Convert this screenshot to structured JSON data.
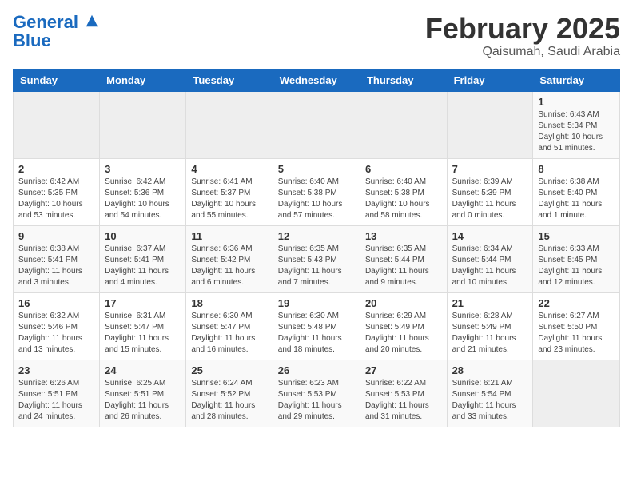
{
  "logo": {
    "line1": "General",
    "line2": "Blue"
  },
  "title": "February 2025",
  "subtitle": "Qaisumah, Saudi Arabia",
  "days_of_week": [
    "Sunday",
    "Monday",
    "Tuesday",
    "Wednesday",
    "Thursday",
    "Friday",
    "Saturday"
  ],
  "weeks": [
    [
      {
        "day": "",
        "info": ""
      },
      {
        "day": "",
        "info": ""
      },
      {
        "day": "",
        "info": ""
      },
      {
        "day": "",
        "info": ""
      },
      {
        "day": "",
        "info": ""
      },
      {
        "day": "",
        "info": ""
      },
      {
        "day": "1",
        "info": "Sunrise: 6:43 AM\nSunset: 5:34 PM\nDaylight: 10 hours\nand 51 minutes."
      }
    ],
    [
      {
        "day": "2",
        "info": "Sunrise: 6:42 AM\nSunset: 5:35 PM\nDaylight: 10 hours\nand 53 minutes."
      },
      {
        "day": "3",
        "info": "Sunrise: 6:42 AM\nSunset: 5:36 PM\nDaylight: 10 hours\nand 54 minutes."
      },
      {
        "day": "4",
        "info": "Sunrise: 6:41 AM\nSunset: 5:37 PM\nDaylight: 10 hours\nand 55 minutes."
      },
      {
        "day": "5",
        "info": "Sunrise: 6:40 AM\nSunset: 5:38 PM\nDaylight: 10 hours\nand 57 minutes."
      },
      {
        "day": "6",
        "info": "Sunrise: 6:40 AM\nSunset: 5:38 PM\nDaylight: 10 hours\nand 58 minutes."
      },
      {
        "day": "7",
        "info": "Sunrise: 6:39 AM\nSunset: 5:39 PM\nDaylight: 11 hours\nand 0 minutes."
      },
      {
        "day": "8",
        "info": "Sunrise: 6:38 AM\nSunset: 5:40 PM\nDaylight: 11 hours\nand 1 minute."
      }
    ],
    [
      {
        "day": "9",
        "info": "Sunrise: 6:38 AM\nSunset: 5:41 PM\nDaylight: 11 hours\nand 3 minutes."
      },
      {
        "day": "10",
        "info": "Sunrise: 6:37 AM\nSunset: 5:41 PM\nDaylight: 11 hours\nand 4 minutes."
      },
      {
        "day": "11",
        "info": "Sunrise: 6:36 AM\nSunset: 5:42 PM\nDaylight: 11 hours\nand 6 minutes."
      },
      {
        "day": "12",
        "info": "Sunrise: 6:35 AM\nSunset: 5:43 PM\nDaylight: 11 hours\nand 7 minutes."
      },
      {
        "day": "13",
        "info": "Sunrise: 6:35 AM\nSunset: 5:44 PM\nDaylight: 11 hours\nand 9 minutes."
      },
      {
        "day": "14",
        "info": "Sunrise: 6:34 AM\nSunset: 5:44 PM\nDaylight: 11 hours\nand 10 minutes."
      },
      {
        "day": "15",
        "info": "Sunrise: 6:33 AM\nSunset: 5:45 PM\nDaylight: 11 hours\nand 12 minutes."
      }
    ],
    [
      {
        "day": "16",
        "info": "Sunrise: 6:32 AM\nSunset: 5:46 PM\nDaylight: 11 hours\nand 13 minutes."
      },
      {
        "day": "17",
        "info": "Sunrise: 6:31 AM\nSunset: 5:47 PM\nDaylight: 11 hours\nand 15 minutes."
      },
      {
        "day": "18",
        "info": "Sunrise: 6:30 AM\nSunset: 5:47 PM\nDaylight: 11 hours\nand 16 minutes."
      },
      {
        "day": "19",
        "info": "Sunrise: 6:30 AM\nSunset: 5:48 PM\nDaylight: 11 hours\nand 18 minutes."
      },
      {
        "day": "20",
        "info": "Sunrise: 6:29 AM\nSunset: 5:49 PM\nDaylight: 11 hours\nand 20 minutes."
      },
      {
        "day": "21",
        "info": "Sunrise: 6:28 AM\nSunset: 5:49 PM\nDaylight: 11 hours\nand 21 minutes."
      },
      {
        "day": "22",
        "info": "Sunrise: 6:27 AM\nSunset: 5:50 PM\nDaylight: 11 hours\nand 23 minutes."
      }
    ],
    [
      {
        "day": "23",
        "info": "Sunrise: 6:26 AM\nSunset: 5:51 PM\nDaylight: 11 hours\nand 24 minutes."
      },
      {
        "day": "24",
        "info": "Sunrise: 6:25 AM\nSunset: 5:51 PM\nDaylight: 11 hours\nand 26 minutes."
      },
      {
        "day": "25",
        "info": "Sunrise: 6:24 AM\nSunset: 5:52 PM\nDaylight: 11 hours\nand 28 minutes."
      },
      {
        "day": "26",
        "info": "Sunrise: 6:23 AM\nSunset: 5:53 PM\nDaylight: 11 hours\nand 29 minutes."
      },
      {
        "day": "27",
        "info": "Sunrise: 6:22 AM\nSunset: 5:53 PM\nDaylight: 11 hours\nand 31 minutes."
      },
      {
        "day": "28",
        "info": "Sunrise: 6:21 AM\nSunset: 5:54 PM\nDaylight: 11 hours\nand 33 minutes."
      },
      {
        "day": "",
        "info": ""
      }
    ]
  ]
}
